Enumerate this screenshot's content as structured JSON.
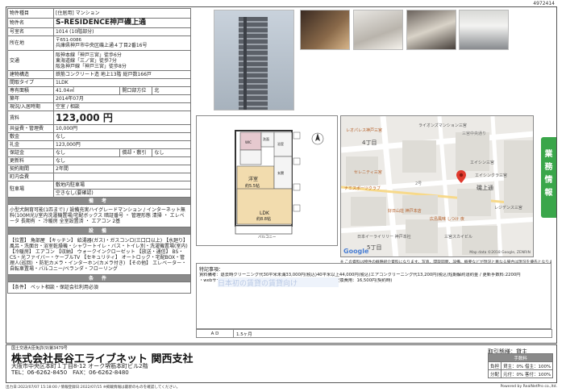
{
  "page_id": "4972414",
  "property": {
    "type_label": "物件種目",
    "type_value": "[住居用] マンション",
    "name_label": "物件名",
    "name_value": "S-RESIDENCE神戸磯上通",
    "room_label": "号室名",
    "room_value": "1014 (10階部分)",
    "location_label": "所在地",
    "postal": "〒651-0086",
    "address": "兵庫県神戸市中央区磯上通４丁目2番16号",
    "transport_label": "交通",
    "transport": [
      "阪神本線「神戸三宮」徒歩6分",
      "東海道線「三ノ宮」徒歩7分",
      "阪急神戸線「神戸三宮」徒歩8分"
    ],
    "structure_label": "建物構造",
    "structure_value": "鉄筋コンクリート造 地上13階 総戸数166戸",
    "layout_label": "間取タイプ",
    "layout_value": "1LDK",
    "area_label": "専有面積",
    "area_value": "41.04㎡",
    "opening_label": "開口部方位",
    "opening_value": "北",
    "built_label": "築年",
    "built_value": "2014年07月",
    "status_label": "現況/入居時期",
    "status_value": "空室 / 相談",
    "rent_label": "賃料",
    "rent_value": "123,000 円",
    "common_label": "共益費・管理費",
    "common_value": "10,000円",
    "deposit_label": "敷金",
    "deposit_value": "なし",
    "key_label": "礼金",
    "key_value": "123,000円",
    "guarantee_label": "保証金",
    "guarantee_value": "なし",
    "amortize_label": "償却・敷引",
    "amortize_value": "なし",
    "renew_label": "更新料",
    "renew_value": "なし",
    "term_label": "契約期間",
    "term_value": "2年間",
    "assoc_label": "町内会費",
    "assoc_value": "",
    "parking_label": "駐車場",
    "parking_value1": "敷地内駐車場",
    "parking_value2": "空きなし(要確認)"
  },
  "bands": {
    "remarks": "備 考",
    "facilities": "設 備",
    "conditions": "条 件"
  },
  "remarks_text": "小型犬飼育可能(1匹まで) / 設備充実ハイグレードマンション / インターネット無料(100M光)/室内洗濯機置場/宅配ボックス 暗証番号 ・ 管理形態 清掃 ・ エレベータ 長期有 ・ 冷暖房 全室設置済 ・ エアコン 2基",
  "facilities_text": "【位置】 角部屋 【キッチン】 給湯器(ガス)・ガスコンロ(三口口以上) 【水廻り】 風呂・洗面台・浴室乾燥機・シャワートイレ・バス・トイレ別・洗濯機置場(室内) 【冷暖房】 エアコン 【収納】 ウォークインクローゼット 【放送・通信】 BS・CS・光ファイバー・ケーブルTV 【セキュリティ】 オートロック・宅配BOX・管理人(巡回) ・防犯カメラ・インターホン(カメラ付き) 【その他】 エレベーター・自転車置場・バルコニー/ベランダ・フローリング",
  "conditions_text": "【条件】 ペット相談・保証会社利用必須",
  "floor_plan": {
    "room1_label": "洋室",
    "room1_size": "約5.5帖",
    "room2_label": "LDK",
    "room2_size": "約8.8帖",
    "balcony_label": "バルコニー",
    "closet_label": "WIC",
    "entrance_label": "玄関",
    "bath_label": "浴室",
    "wash_label": "洗面"
  },
  "map": {
    "labels": [
      {
        "text": "三宮中央通り",
        "cls": "road"
      },
      {
        "text": "レオパレス神戸三宮",
        "cls": "poi"
      },
      {
        "text": "ライオンズマンション三宮",
        "cls": ""
      },
      {
        "text": "4丁目",
        "cls": "big"
      },
      {
        "text": "セレニティ三宮",
        "cls": "poi"
      },
      {
        "text": "エイシン三宮",
        "cls": ""
      },
      {
        "text": "ナミスポーツクラブ",
        "cls": "poi"
      },
      {
        "text": "エイシンクラ三宮",
        "cls": ""
      },
      {
        "text": "レジデンス三宮",
        "cls": ""
      },
      {
        "text": "磯上通",
        "cls": "big"
      },
      {
        "text": "好日山荘 神戸本店",
        "cls": "poi"
      },
      {
        "text": "広島風味 しつけ 夜",
        "cls": "poi"
      },
      {
        "text": "日本イーライリリー 神戸本社",
        "cls": ""
      },
      {
        "text": "5丁目",
        "cls": "big"
      },
      {
        "text": "2号",
        "cls": "road"
      },
      {
        "text": "三宮スカイビル",
        "cls": ""
      }
    ],
    "copyright": "Map data ©2018 Google, ZENRIN",
    "logo": "Google"
  },
  "fine_note": "※ この資料は物件の概略紹介資料になります。写真、間取図面、設備、概要などが現況と異なる場合は現況を優先となります。",
  "special": {
    "header": "特記事項：",
    "lines": [
      "賃料備考：退去時クリーニング代30平米未満33,000円(税込)40平米以上44,000円(税込)エアコンクリーニング代13,200円(税込)短期解約違約金 / 更新手数料:2200円",
      "・webサービス広告掲載 [許可] ・保険・保険要加入 (指定なし) ・カギ交換費用：16,500円(契約時)"
    ],
    "watermark": "日本初の賃貸の賃貸向け"
  },
  "ad": {
    "label": "A D",
    "value": "1.5ヶ月"
  },
  "side_tab": "業務情報",
  "footer": {
    "license": "国土交通大臣免許(9)第3479号",
    "company": "株式会社長谷工ライブネット 関西支社",
    "address": "大阪市中央区本町１丁目8-12 オーク堺筋本町ビル2階",
    "tel": "TEL：06-6262-8450　FAX：06-6262-8480",
    "deal_label": "取引態様：",
    "deal_value": "貸主",
    "fee_header": "手数料",
    "fee_rows": [
      {
        "k": "負担",
        "v": "貸主：0% 借主：100%"
      },
      {
        "k": "分配",
        "v": "元付：0% 客付：100%"
      }
    ]
  },
  "bottom": {
    "left": "出力日:2022/07/07 15:18:00 / 情報登録日:2022/07/15 ※掲載情報は最新のものを確認してください。",
    "right": "Powered by RealNetPro co.,ltd."
  }
}
